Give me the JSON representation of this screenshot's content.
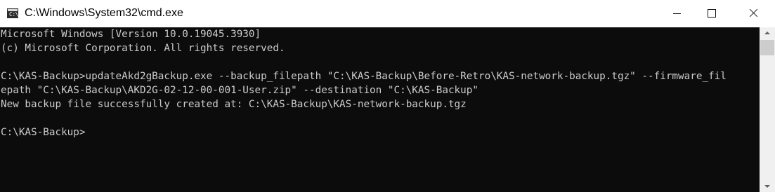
{
  "window": {
    "title": "C:\\Windows\\System32\\cmd.exe",
    "icon": "cmd-icon",
    "icon_glyph": "C:\\.",
    "controls": [
      "minimize-icon",
      "maximize-icon",
      "close-icon"
    ]
  },
  "console": {
    "lines": [
      "Microsoft Windows [Version 10.0.19045.3930]",
      "(c) Microsoft Corporation. All rights reserved.",
      "",
      "C:\\KAS-Backup>updateAkd2gBackup.exe --backup_filepath \"C:\\KAS-Backup\\Before-Retro\\KAS-network-backup.tgz\" --firmware_fil",
      "epath \"C:\\KAS-Backup\\AKD2G-02-12-00-001-User.zip\" --destination \"C:\\KAS-Backup\"",
      "New backup file successfully created at: C:\\KAS-Backup\\KAS-network-backup.tgz",
      "",
      "C:\\KAS-Backup>"
    ]
  },
  "colors": {
    "console_background": "#0c0c0c",
    "console_text": "#cccccc",
    "titlebar_background": "#ffffff",
    "scrollbar_track": "#f0f0f0",
    "scrollbar_thumb": "#cdcdcd"
  }
}
